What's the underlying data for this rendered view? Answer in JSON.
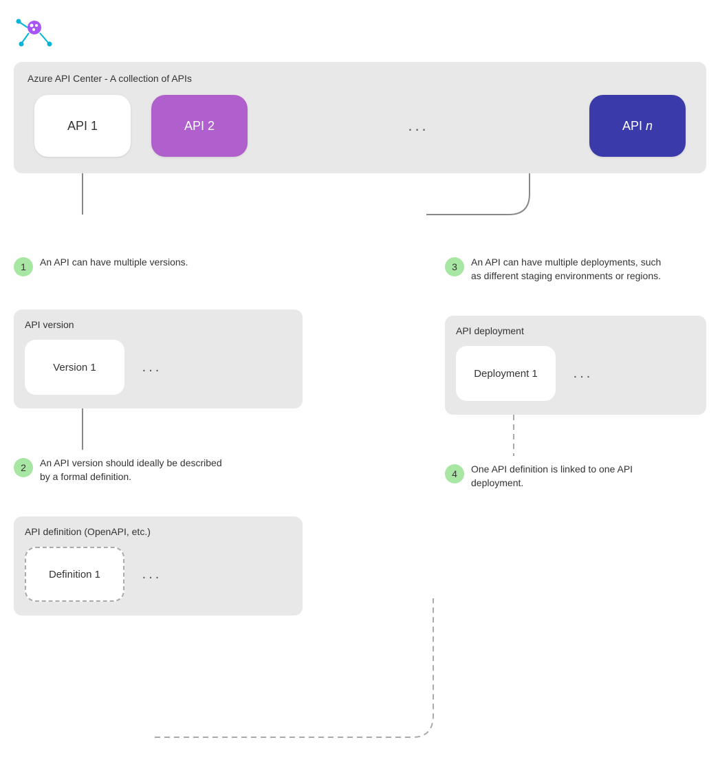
{
  "logo": {
    "alt": "Azure API Center logo"
  },
  "apiCenter": {
    "title": "Azure API Center - A collection of APIs",
    "apis": [
      {
        "label": "API 1",
        "style": "white"
      },
      {
        "label": "API 2",
        "style": "purple"
      },
      {
        "label": "API n",
        "style": "blue"
      }
    ],
    "ellipsis": "..."
  },
  "steps": {
    "step1": {
      "number": "1",
      "text": "An API can have multiple versions."
    },
    "step2": {
      "number": "2",
      "text": "An API version should ideally be described by a formal definition."
    },
    "step3": {
      "number": "3",
      "text": "An API can have multiple deployments, such as different staging environments or regions."
    },
    "step4": {
      "number": "4",
      "text": "One API definition is linked to one API deployment."
    }
  },
  "apiVersion": {
    "title": "API version",
    "cards": [
      {
        "label": "Version 1"
      }
    ],
    "ellipsis": "..."
  },
  "apiDeployment": {
    "title": "API deployment",
    "cards": [
      {
        "label": "Deployment 1"
      }
    ],
    "ellipsis": "..."
  },
  "apiDefinition": {
    "title": "API definition (OpenAPI, etc.)",
    "cards": [
      {
        "label": "Definition 1"
      }
    ],
    "ellipsis": "..."
  }
}
